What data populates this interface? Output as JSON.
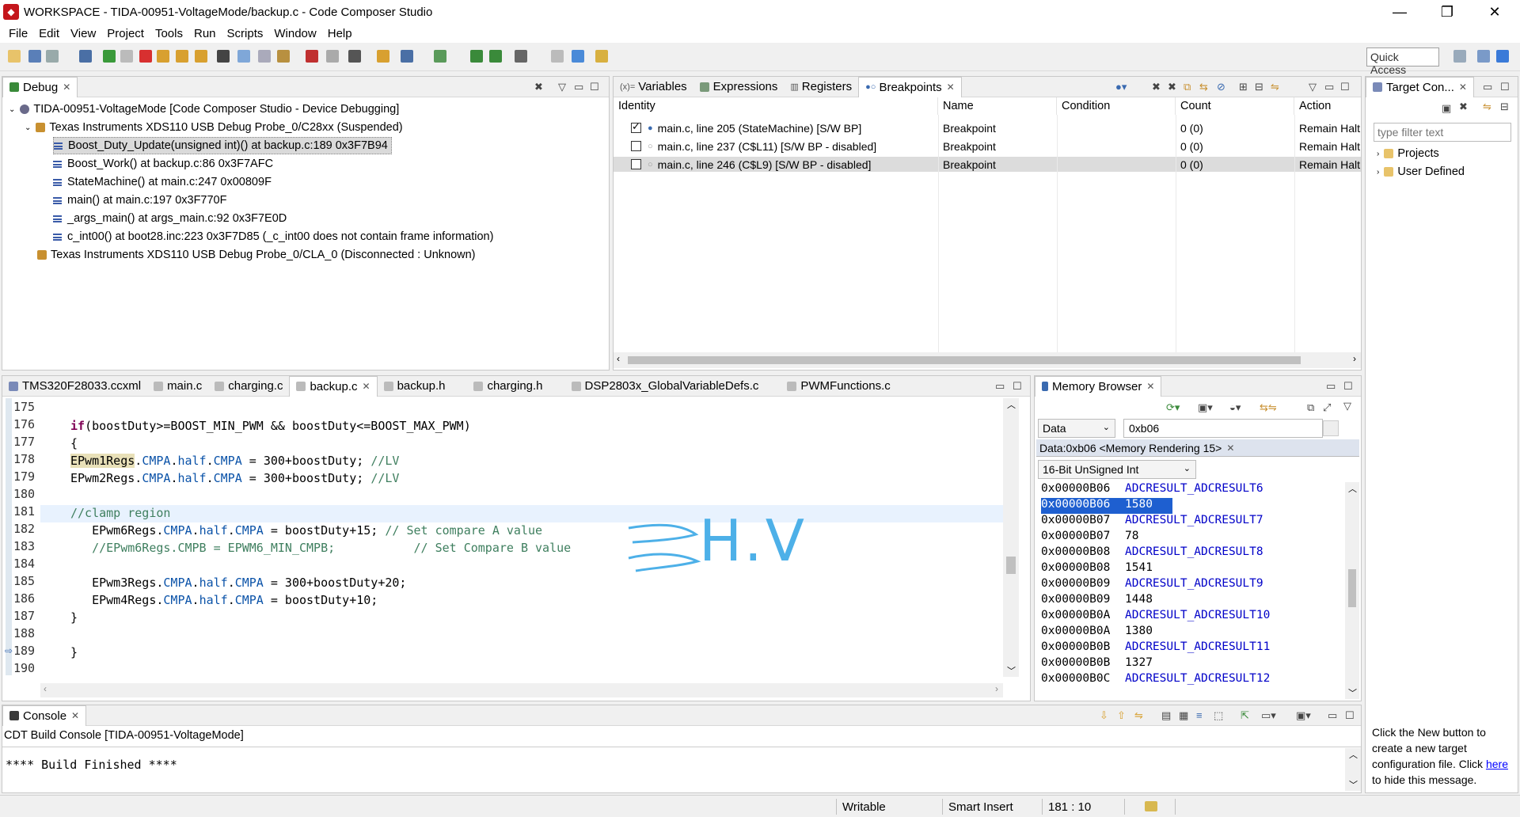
{
  "window": {
    "title": "WORKSPACE - TIDA-00951-VoltageMode/backup.c - Code Composer Studio",
    "app_icon": "ccs-icon"
  },
  "menu": [
    "File",
    "Edit",
    "View",
    "Project",
    "Tools",
    "Run",
    "Scripts",
    "Window",
    "Help"
  ],
  "toolbar": {
    "quick_access": "Quick Access"
  },
  "debug": {
    "tab": "Debug",
    "tree": [
      "TIDA-00951-VoltageMode [Code Composer Studio - Device Debugging]",
      "Texas Instruments XDS110 USB Debug Probe_0/C28xx (Suspended)",
      "Boost_Duty_Update(unsigned int)() at backup.c:189 0x3F7B94",
      "Boost_Work() at backup.c:86 0x3F7AFC",
      "StateMachine() at main.c:247 0x00809F",
      "main() at main.c:197 0x3F770F",
      "_args_main() at args_main.c:92 0x3F7E0D",
      "c_int00() at boot28.inc:223 0x3F7D85  (_c_int00 does not contain frame information)",
      "Texas Instruments XDS110 USB Debug Probe_0/CLA_0 (Disconnected : Unknown)"
    ]
  },
  "bp_panel": {
    "tabs": [
      "Variables",
      "Expressions",
      "Registers",
      "Breakpoints"
    ],
    "columns": [
      "Identity",
      "Name",
      "Condition",
      "Count",
      "Action"
    ],
    "rows": [
      {
        "identity": "main.c, line 205 (StateMachine)  [S/W BP]",
        "name": "Breakpoint",
        "condition": "",
        "count": "0 (0)",
        "action": "Remain Halt",
        "checked": true
      },
      {
        "identity": "main.c, line 237 (C$L11)  [S/W BP - disabled]",
        "name": "Breakpoint",
        "condition": "",
        "count": "0 (0)",
        "action": "Remain Halt",
        "checked": false
      },
      {
        "identity": "main.c, line 246 (C$L9)  [S/W BP - disabled]",
        "name": "Breakpoint",
        "condition": "",
        "count": "0 (0)",
        "action": "Remain Halt",
        "checked": false
      }
    ]
  },
  "target": {
    "tab": "Target Con...",
    "filter_placeholder": "type filter text",
    "items": [
      "Projects",
      "User Defined"
    ],
    "message_pre": "Click the New button to create a new target configuration file. Click",
    "message_link": "here",
    "message_post": "to hide this message."
  },
  "editor": {
    "tabs": [
      "TMS320F28033.ccxml",
      "main.c",
      "charging.c",
      "backup.c",
      "backup.h",
      "charging.h",
      "DSP2803x_GlobalVariableDefs.c",
      "PWMFunctions.c"
    ],
    "line_numbers": [
      "175",
      "176",
      "177",
      "178",
      "179",
      "180",
      "181",
      "182",
      "183",
      "184",
      "185",
      "186",
      "187",
      "188",
      "189",
      "190"
    ],
    "annotation": "H.V"
  },
  "memory": {
    "tab": "Memory Browser",
    "space": "Data",
    "address": "0xb06",
    "rendering_tab": "Data:0xb06 <Memory Rendering 15>",
    "format": "16-Bit UnSigned Int",
    "rows": [
      {
        "addr": "0x00000B06",
        "val": "ADCRESULT_ADCRESULT6",
        "sym": true
      },
      {
        "addr": "0x00000B06",
        "val": "1580",
        "sel": true
      },
      {
        "addr": "0x00000B07",
        "val": "ADCRESULT_ADCRESULT7",
        "sym": true
      },
      {
        "addr": "0x00000B07",
        "val": "78"
      },
      {
        "addr": "0x00000B08",
        "val": "ADCRESULT_ADCRESULT8",
        "sym": true
      },
      {
        "addr": "0x00000B08",
        "val": "1541"
      },
      {
        "addr": "0x00000B09",
        "val": "ADCRESULT_ADCRESULT9",
        "sym": true
      },
      {
        "addr": "0x00000B09",
        "val": "1448"
      },
      {
        "addr": "0x00000B0A",
        "val": "ADCRESULT_ADCRESULT10",
        "sym": true
      },
      {
        "addr": "0x00000B0A",
        "val": "1380"
      },
      {
        "addr": "0x00000B0B",
        "val": "ADCRESULT_ADCRESULT11",
        "sym": true
      },
      {
        "addr": "0x00000B0B",
        "val": "1327"
      },
      {
        "addr": "0x00000B0C",
        "val": "ADCRESULT_ADCRESULT12",
        "sym": true
      }
    ]
  },
  "console": {
    "tab": "Console",
    "name": "CDT Build Console [TIDA-00951-VoltageMode]",
    "output": "**** Build Finished ****"
  },
  "status": {
    "writable": "Writable",
    "insert": "Smart Insert",
    "position": "181 : 10"
  }
}
